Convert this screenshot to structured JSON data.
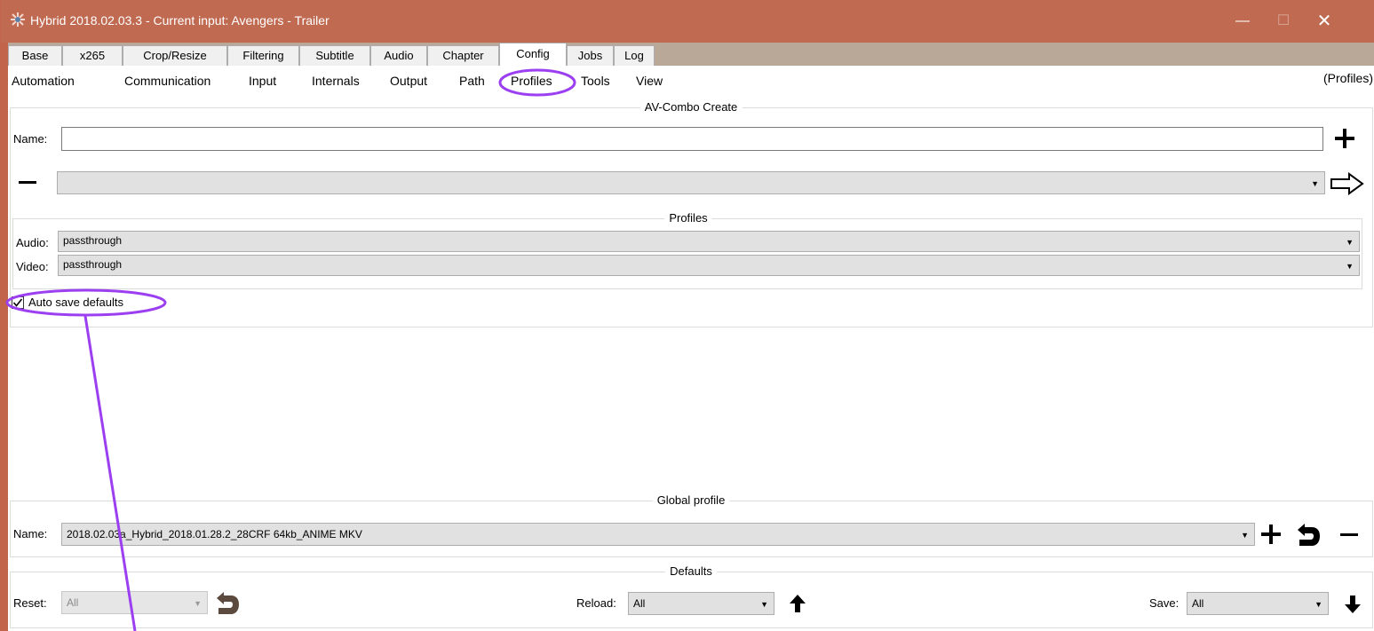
{
  "window": {
    "title": "Hybrid 2018.02.03.3 - Current input: Avengers - Trailer",
    "minimize": "—",
    "maximize": "☐",
    "close": "✕"
  },
  "tabs": [
    {
      "label": "Base"
    },
    {
      "label": "x265"
    },
    {
      "label": "Crop/Resize"
    },
    {
      "label": "Filtering"
    },
    {
      "label": "Subtitle"
    },
    {
      "label": "Audio"
    },
    {
      "label": "Chapter"
    },
    {
      "label": "Config",
      "active": true
    },
    {
      "label": "Jobs"
    },
    {
      "label": "Log"
    }
  ],
  "subtabs": [
    {
      "label": "Automation"
    },
    {
      "label": "Communication"
    },
    {
      "label": "Input"
    },
    {
      "label": "Internals"
    },
    {
      "label": "Output"
    },
    {
      "label": "Path"
    },
    {
      "label": "Profiles",
      "active": true
    },
    {
      "label": "Tools"
    },
    {
      "label": "View"
    }
  ],
  "subnav_right": "(Profiles)",
  "av_combo": {
    "title": "AV-Combo Create",
    "name_label": "Name:",
    "name_value": "",
    "combo_value": "",
    "profiles": {
      "title": "Profiles",
      "audio_label": "Audio:",
      "audio_value": "passthrough",
      "video_label": "Video:",
      "video_value": "passthrough"
    }
  },
  "auto_save": {
    "label": "Auto save defaults",
    "checked": true
  },
  "global_profile": {
    "title": "Global profile",
    "name_label": "Name:",
    "name_value": "2018.02.03a_Hybrid_2018.01.28.2_28CRF 64kb_ANIME MKV"
  },
  "defaults": {
    "title": "Defaults",
    "reset_label": "Reset:",
    "reset_value": "All",
    "reload_label": "Reload:",
    "reload_value": "All",
    "save_label": "Save:",
    "save_value": "All"
  },
  "icons": {
    "app": "hybrid-app-icon",
    "add": "plus-icon",
    "remove": "minus-icon",
    "apply": "arrow-right-icon",
    "undo": "undo-icon",
    "up": "arrow-up-icon",
    "down": "arrow-down-icon"
  },
  "colors": {
    "titlebar": "#c06a52",
    "tabbar": "#b9a797",
    "annotation": "#9b3ff0"
  }
}
